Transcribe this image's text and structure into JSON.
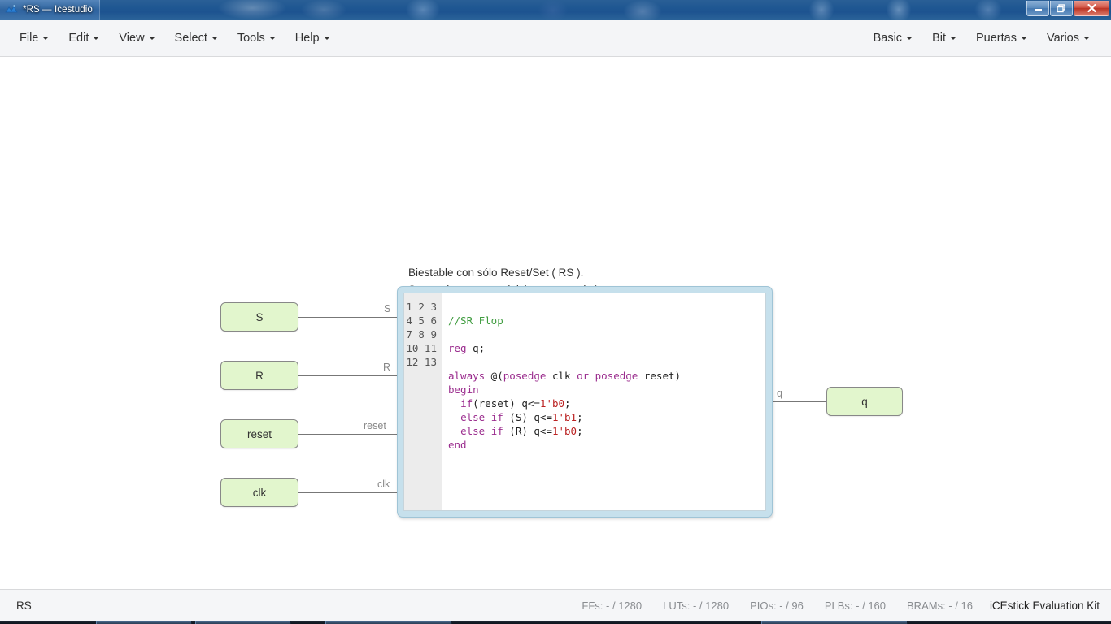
{
  "window": {
    "title": "*RS — Icestudio",
    "app_icon": "icestudio-icon",
    "buttons": {
      "minimize": "minimize-icon",
      "restore": "restore-icon",
      "close": "close-icon"
    }
  },
  "menubar": {
    "left_items": [
      {
        "label": "File"
      },
      {
        "label": "Edit"
      },
      {
        "label": "View"
      },
      {
        "label": "Select"
      },
      {
        "label": "Tools"
      },
      {
        "label": "Help"
      }
    ],
    "right_items": [
      {
        "label": "Basic"
      },
      {
        "label": "Bit"
      },
      {
        "label": "Puertas"
      },
      {
        "label": "Varios"
      }
    ]
  },
  "canvas": {
    "description": {
      "line1": "Biestable con sólo Reset/Set ( RS ).",
      "line2": "Se puede usar para iniciar o parar algún proceso."
    },
    "input_blocks": [
      {
        "label": "S",
        "port": "S"
      },
      {
        "label": "R",
        "port": "R"
      },
      {
        "label": "reset",
        "port": "reset"
      },
      {
        "label": "clk",
        "port": "clk"
      }
    ],
    "output_blocks": [
      {
        "label": "q",
        "port": "q"
      }
    ],
    "code_block": {
      "line_numbers": [
        "1",
        "2",
        "3",
        "4",
        "5",
        "6",
        "7",
        "8",
        "9",
        "10",
        "11",
        "12",
        "13"
      ],
      "lines": [
        {
          "tokens": []
        },
        {
          "tokens": [
            {
              "t": "//SR Flop",
              "c": "comment"
            }
          ]
        },
        {
          "tokens": []
        },
        {
          "tokens": [
            {
              "t": "reg",
              "c": "keyword"
            },
            {
              "t": " q;",
              "c": "plain"
            }
          ]
        },
        {
          "tokens": []
        },
        {
          "tokens": [
            {
              "t": "always",
              "c": "keyword"
            },
            {
              "t": " @(",
              "c": "plain"
            },
            {
              "t": "posedge",
              "c": "keyword"
            },
            {
              "t": " clk ",
              "c": "plain"
            },
            {
              "t": "or",
              "c": "keyword"
            },
            {
              "t": " ",
              "c": "plain"
            },
            {
              "t": "posedge",
              "c": "keyword"
            },
            {
              "t": " reset)",
              "c": "plain"
            }
          ]
        },
        {
          "tokens": [
            {
              "t": "begin",
              "c": "keyword"
            }
          ]
        },
        {
          "tokens": [
            {
              "t": "  ",
              "c": "plain"
            },
            {
              "t": "if",
              "c": "keyword"
            },
            {
              "t": "(reset) q<=",
              "c": "plain"
            },
            {
              "t": "1'b0",
              "c": "number"
            },
            {
              "t": ";",
              "c": "plain"
            }
          ]
        },
        {
          "tokens": [
            {
              "t": "  ",
              "c": "plain"
            },
            {
              "t": "else",
              "c": "keyword"
            },
            {
              "t": " ",
              "c": "plain"
            },
            {
              "t": "if",
              "c": "keyword"
            },
            {
              "t": " (S) q<=",
              "c": "plain"
            },
            {
              "t": "1'b1",
              "c": "number"
            },
            {
              "t": ";",
              "c": "plain"
            }
          ]
        },
        {
          "tokens": [
            {
              "t": "  ",
              "c": "plain"
            },
            {
              "t": "else",
              "c": "keyword"
            },
            {
              "t": " ",
              "c": "plain"
            },
            {
              "t": "if",
              "c": "keyword"
            },
            {
              "t": " (R) q<=",
              "c": "plain"
            },
            {
              "t": "1'b0",
              "c": "number"
            },
            {
              "t": ";",
              "c": "plain"
            }
          ]
        },
        {
          "tokens": [
            {
              "t": "end",
              "c": "keyword"
            }
          ]
        },
        {
          "tokens": []
        },
        {
          "tokens": []
        }
      ]
    }
  },
  "statusbar": {
    "project_name": "RS",
    "stats": [
      {
        "label": "FFs:",
        "value": "- / 1280"
      },
      {
        "label": "LUTs:",
        "value": "- / 1280"
      },
      {
        "label": "PIOs:",
        "value": "- / 96"
      },
      {
        "label": "PLBs:",
        "value": "- / 160"
      },
      {
        "label": "BRAMs:",
        "value": "- / 16"
      }
    ],
    "board": "iCEstick Evaluation Kit"
  },
  "colors": {
    "io_block_fill": "#e2f6cd",
    "code_block_border": "#c6e0ec",
    "accent_blue": "#1f5792",
    "keyword": "#9b2d8e",
    "comment": "#3f9c3f",
    "number": "#bb2222"
  }
}
